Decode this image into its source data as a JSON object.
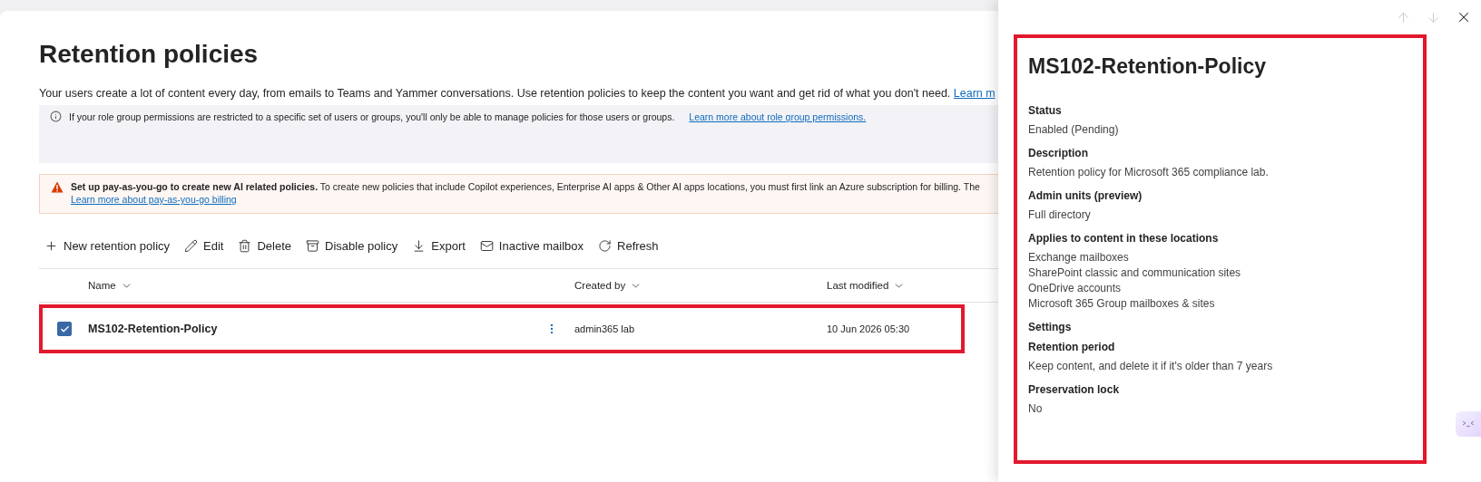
{
  "page": {
    "title": "Retention policies",
    "description": "Your users create a lot of content every day, from emails to Teams and Yammer conversations. Use retention policies to keep the content you want and get rid of what you don't need.",
    "description_link": "Learn m"
  },
  "info_banner": {
    "text": "If your role group permissions are restricted to a specific set of users or groups, you'll only be able to manage policies for those users or groups.",
    "link": "Learn more about role group permissions."
  },
  "warning_banner": {
    "title": "Set up pay-as-you-go to create new AI related policies.",
    "text": "To create new policies that include Copilot experiences, Enterprise AI apps & Other AI apps locations, you must first link an Azure subscription for billing. The",
    "link": "Learn more about pay-as-you-go billing"
  },
  "toolbar": [
    "New retention policy",
    "Edit",
    "Delete",
    "Disable policy",
    "Export",
    "Inactive mailbox",
    "Refresh"
  ],
  "table": {
    "columns": [
      "Name",
      "Created by",
      "Last modified"
    ],
    "rows": [
      {
        "name": "MS102-Retention-Policy",
        "created_by": "admin365 lab",
        "last_modified": "10 Jun 2026 05:30",
        "selected": true,
        "highlighted": true
      }
    ]
  },
  "details_panel": {
    "highlighted": true,
    "title": "MS102-Retention-Policy",
    "sections": [
      {
        "kind": "field",
        "label": "Status",
        "values": [
          "Enabled (Pending)"
        ]
      },
      {
        "kind": "field",
        "label": "Description",
        "values": [
          "Retention policy for Microsoft 365 compliance lab."
        ]
      },
      {
        "kind": "field",
        "label": "Admin units (preview)",
        "values": [
          "Full directory"
        ]
      },
      {
        "kind": "field",
        "label": "Applies to content in these locations",
        "values": [
          "Exchange mailboxes",
          "SharePoint classic and communication sites",
          "OneDrive accounts",
          "Microsoft 365 Group mailboxes & sites"
        ]
      },
      {
        "kind": "heading",
        "label": "Settings"
      },
      {
        "kind": "field",
        "label": "Retention period",
        "values": [
          "Keep content, and delete it if it's older than 7 years"
        ]
      },
      {
        "kind": "field",
        "label": "Preservation lock",
        "values": [
          "No"
        ]
      }
    ]
  }
}
